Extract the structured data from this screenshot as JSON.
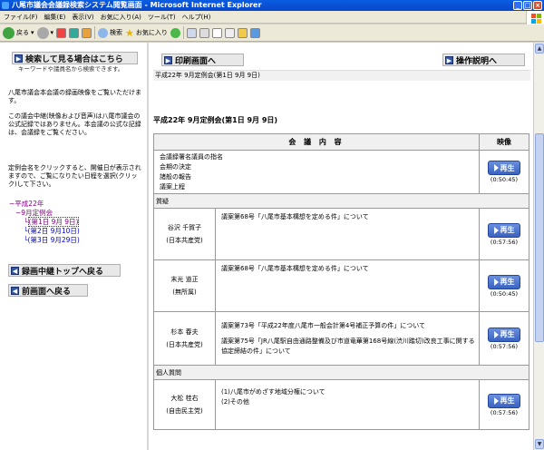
{
  "window": {
    "title": "八尾市議会会議録検索システム閲覧画面 - Microsoft Internet Explorer"
  },
  "menu": [
    "ファイル(F)",
    "編集(E)",
    "表示(V)",
    "お気に入り(A)",
    "ツール(T)",
    "ヘルプ(H)"
  ],
  "toolbar": {
    "back": "戻る",
    "search": "検索",
    "favorites": "お気に入り"
  },
  "sidebar": {
    "search_button": "検索して見る場合はこちら",
    "search_note": "キーワードや議員名から検索できます。",
    "desc1": "八尾市議会本会議の録画映像をご覧いただけます。",
    "desc2": "この議会中継(映像および音声)は八尾市議会の公式記録ではありません。本会議の公式な記録は、会議録をご覧ください。",
    "instruction": "定例会名をクリックすると、開催日が表示されますので、ご覧になりたい日程を選択(クリック)して下さい。",
    "tree": {
      "year": "平成22年",
      "session": "9月定例会",
      "days": [
        "(第1日 9月 9日)",
        "(第2日 9月10日)",
        "(第3日 9月29日)"
      ]
    },
    "top_button": "録画中継トップへ戻る",
    "prev_button": "前画面へ戻る"
  },
  "main": {
    "print_button": "印刷画面へ",
    "help_button": "操作説明へ",
    "strip": "平成22年 9月定例会(第1日 9月 9日)",
    "heading": "平成22年 9月定例会(第1日 9月 9日)",
    "col_content": "会 議 内 容",
    "col_video": "映像",
    "play_label": "再生",
    "rows": [
      {
        "items": [
          "会議録署名議員の指名",
          "会期の決定",
          "諸般の報告",
          "議案上程"
        ],
        "duration": "(0:50:45)"
      },
      {
        "section": "質疑"
      },
      {
        "name": "谷沢 千賀子",
        "party": "(日本共産党)",
        "items": [
          "議案第68号「八尾市基本構想を定める件」について"
        ],
        "duration": "(0:57:56)"
      },
      {
        "name": "末光 道正",
        "party": "(無所属)",
        "items": [
          "議案第68号「八尾市基本構想を定める件」について"
        ],
        "duration": "(0:50:45)"
      },
      {
        "name": "杉本 春夫",
        "party": "(日本共産党)",
        "items": [
          "議案第73号「平成22年度八尾市一般会計第4号補正予算の件」について",
          "議案第75号「JR八尾駅自由通路整備及び市道竜華第168号線(渋川踏切)改良工事に関する協定締結の件」について"
        ],
        "duration": "(0:57:56)"
      },
      {
        "section": "個人質問"
      },
      {
        "name": "大松 桂右",
        "party": "(自由民主党)",
        "items": [
          "(1)八尾市がめざす地域分権について",
          "(2)その他"
        ],
        "duration": "(0:57:56)"
      }
    ]
  }
}
